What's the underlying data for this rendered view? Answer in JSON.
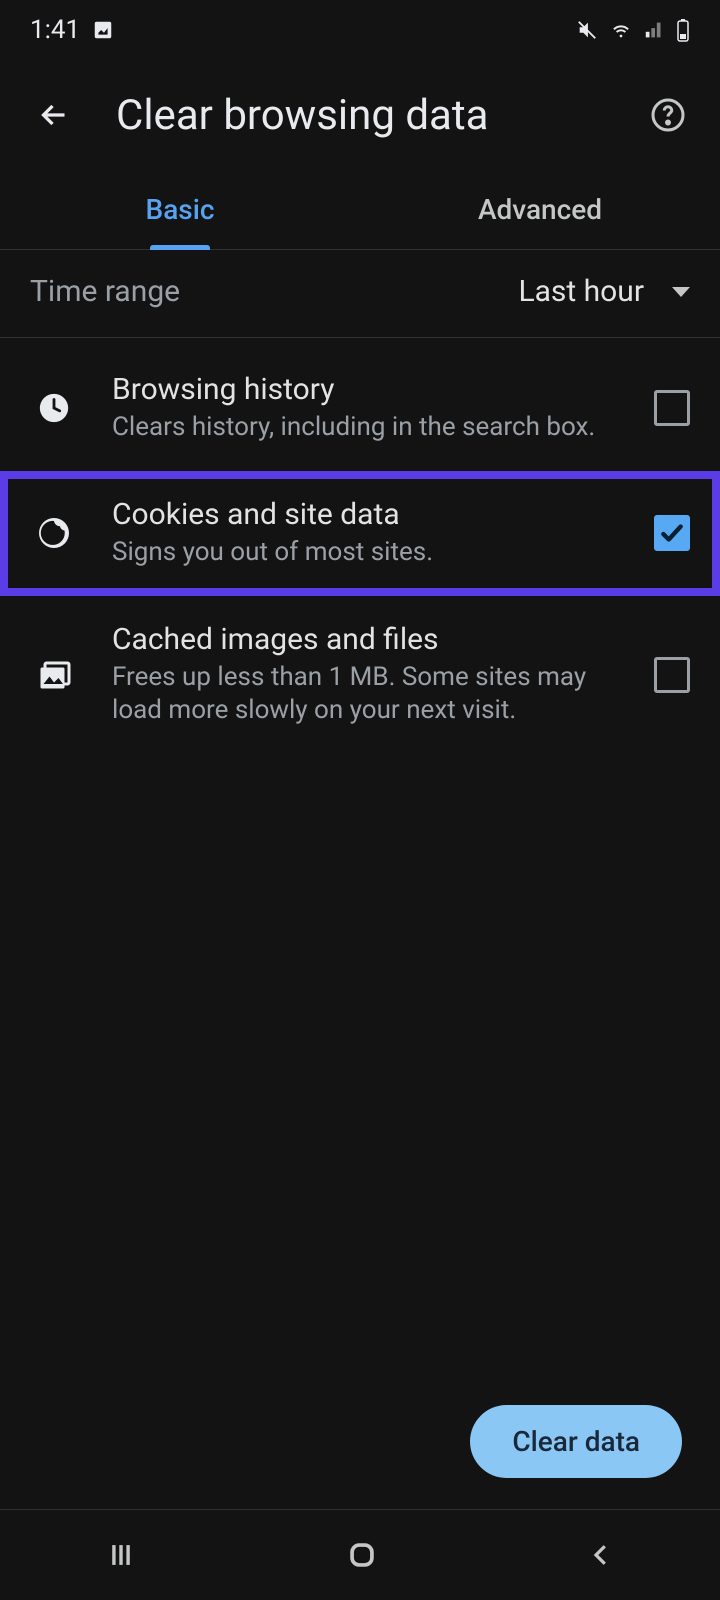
{
  "status": {
    "time": "1:41"
  },
  "header": {
    "title": "Clear browsing data"
  },
  "tabs": {
    "basic": "Basic",
    "advanced": "Advanced",
    "active": "basic"
  },
  "time_range": {
    "label": "Time range",
    "value": "Last hour"
  },
  "items": [
    {
      "title": "Browsing history",
      "sub": "Clears history, including in the search box.",
      "checked": false,
      "highlight": false
    },
    {
      "title": "Cookies and site data",
      "sub": "Signs you out of most sites.",
      "checked": true,
      "highlight": true
    },
    {
      "title": "Cached images and files",
      "sub": "Frees up less than 1 MB. Some sites may load more slowly on your next visit.",
      "checked": false,
      "highlight": false
    }
  ],
  "clear_button": "Clear data"
}
